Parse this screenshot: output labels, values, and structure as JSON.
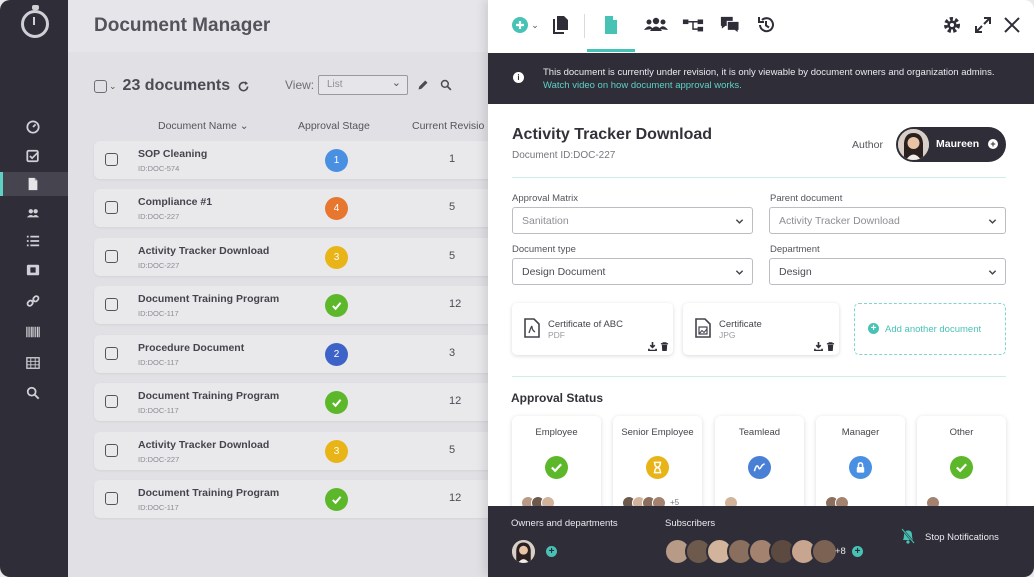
{
  "sidebar": {
    "items": [
      {
        "name": "dashboard-icon"
      },
      {
        "name": "tasks-icon"
      },
      {
        "name": "documents-icon",
        "active": true
      },
      {
        "name": "users-icon"
      },
      {
        "name": "checklist-icon"
      },
      {
        "name": "media-icon"
      },
      {
        "name": "link-icon"
      },
      {
        "name": "barcode-icon"
      },
      {
        "name": "calendar-grid-icon"
      },
      {
        "name": "search-icon"
      }
    ]
  },
  "list": {
    "title": "Document Manager",
    "count": "23 documents",
    "view_label": "View:",
    "view_value": "List",
    "columns": {
      "name": "Document Name",
      "stage": "Approval Stage",
      "revision": "Current Revisio"
    },
    "rows": [
      {
        "name": "SOP Cleaning",
        "id": "ID:DOC-574",
        "stage": "1",
        "stage_color": "#4a90e2",
        "revision": "1"
      },
      {
        "name": "Compliance #1",
        "id": "ID:DOC-227",
        "stage": "4",
        "stage_color": "#e7772e",
        "revision": "5"
      },
      {
        "name": "Activity Tracker Download",
        "id": "ID:DOC-227",
        "stage": "3",
        "stage_color": "#e8b417",
        "revision": "5"
      },
      {
        "name": "Document Training Program",
        "id": "ID:DOC-117",
        "stage": "check",
        "stage_color": "#5cb82a",
        "revision": "12"
      },
      {
        "name": "Procedure Document",
        "id": "ID:DOC-117",
        "stage": "2",
        "stage_color": "#3e63c8",
        "revision": "3"
      },
      {
        "name": "Document Training Program",
        "id": "ID:DOC-117",
        "stage": "check",
        "stage_color": "#5cb82a",
        "revision": "12"
      },
      {
        "name": "Activity Tracker Download",
        "id": "ID:DOC-227",
        "stage": "3",
        "stage_color": "#e8b417",
        "revision": "5"
      },
      {
        "name": "Document Training Program",
        "id": "ID:DOC-117",
        "stage": "check",
        "stage_color": "#5cb82a",
        "revision": "12"
      }
    ]
  },
  "panel": {
    "notice_text": "This document is currently under revision, it is only viewable by document owners and organization admins. ",
    "notice_link": "Watch video on how document approval works.",
    "title": "Activity Tracker Download",
    "doc_id": "Document ID:DOC-227",
    "author_label": "Author",
    "author_name": "Maureen",
    "fields": {
      "approval_matrix_label": "Approval Matrix",
      "approval_matrix_value": "Sanitation",
      "parent_doc_label": "Parent document",
      "parent_doc_value": "Activity Tracker Download",
      "doc_type_label": "Document type",
      "doc_type_value": "Design Document",
      "department_label": "Department",
      "department_value": "Design"
    },
    "attachments": [
      {
        "name": "Certificate of ABC",
        "ext": "PDF"
      },
      {
        "name": "Certificate",
        "ext": "JPG"
      }
    ],
    "add_document": "Add another document",
    "approval_status_title": "Approval Status",
    "approval_cards": [
      {
        "title": "Employee",
        "status": "approved",
        "color": "#5cb82a",
        "more": ""
      },
      {
        "title": "Senior Employee",
        "status": "pending",
        "color": "#e8b417",
        "more": "+5"
      },
      {
        "title": "Teamlead",
        "status": "signed",
        "color": "#4a7fd6",
        "more": ""
      },
      {
        "title": "Manager",
        "status": "locked",
        "color": "#4a90e2",
        "more": ""
      },
      {
        "title": "Other",
        "status": "approved",
        "color": "#5cb82a",
        "more": ""
      }
    ],
    "footer": {
      "owners_label": "Owners and departments",
      "subscribers_label": "Subscribers",
      "subscribers_more": "+8",
      "stop_notifications": "Stop Notifications"
    }
  },
  "colors": {
    "accent": "#47c3b6",
    "dark": "#2f2e38"
  }
}
